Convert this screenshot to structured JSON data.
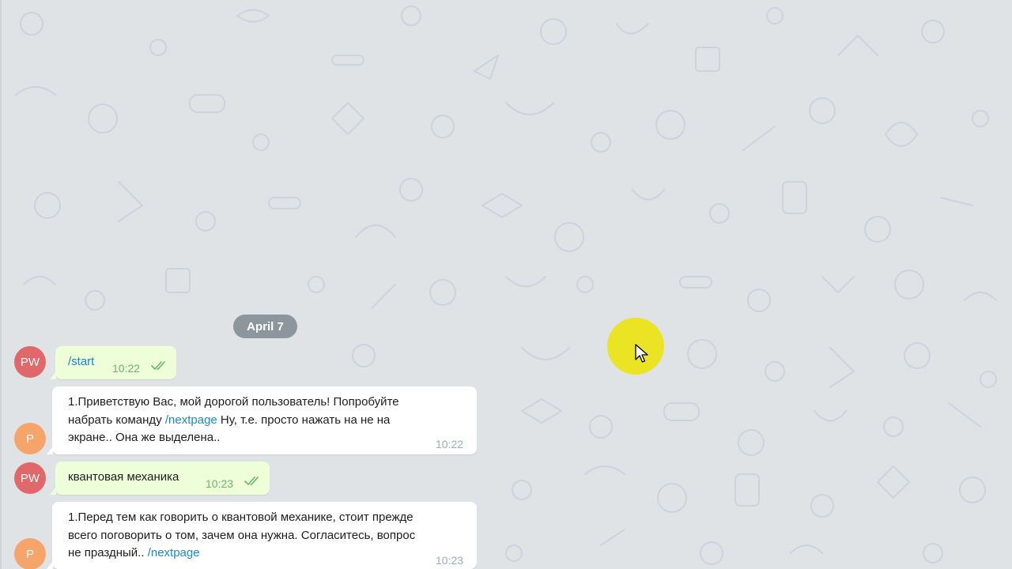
{
  "chat": {
    "date_separator": "April 7",
    "messages": [
      {
        "direction": "out",
        "avatar_initials": "PW",
        "text_parts": [
          {
            "text": "/start",
            "command": true
          }
        ],
        "time": "10:22",
        "read": true
      },
      {
        "direction": "in",
        "avatar_initials": "P",
        "lines": [
          "1.Приветствую Вас, мой дорогой пользователь! Попробуйте",
          "набрать команду ",
          "/nextpage",
          " Ну, т.е. просто нажать на не на",
          "экране.. Она же выделена.."
        ],
        "time": "10:22"
      },
      {
        "direction": "out",
        "avatar_initials": "PW",
        "text": "квантовая механика",
        "time": "10:23",
        "read": true
      },
      {
        "direction": "in",
        "avatar_initials": "P",
        "lines": [
          "1.Перед тем как говорить о квантовой механике, стоит прежде",
          "всего поговорить о том, зачем она нужна. Согласитесь, вопрос",
          "не праздный.. ",
          "/nextpage"
        ],
        "time": "10:23"
      }
    ]
  },
  "colors": {
    "background": "#dfe3e6",
    "outgoing_bubble": "#eefed9",
    "incoming_bubble": "#ffffff",
    "command_link": "#168acd",
    "avatar_pw": "#e0676a",
    "avatar_p": "#f5a56a",
    "cursor_highlight": "#ebe414"
  },
  "icons": {
    "read_status": "double-check-icon",
    "cursor": "mouse-pointer-icon"
  }
}
